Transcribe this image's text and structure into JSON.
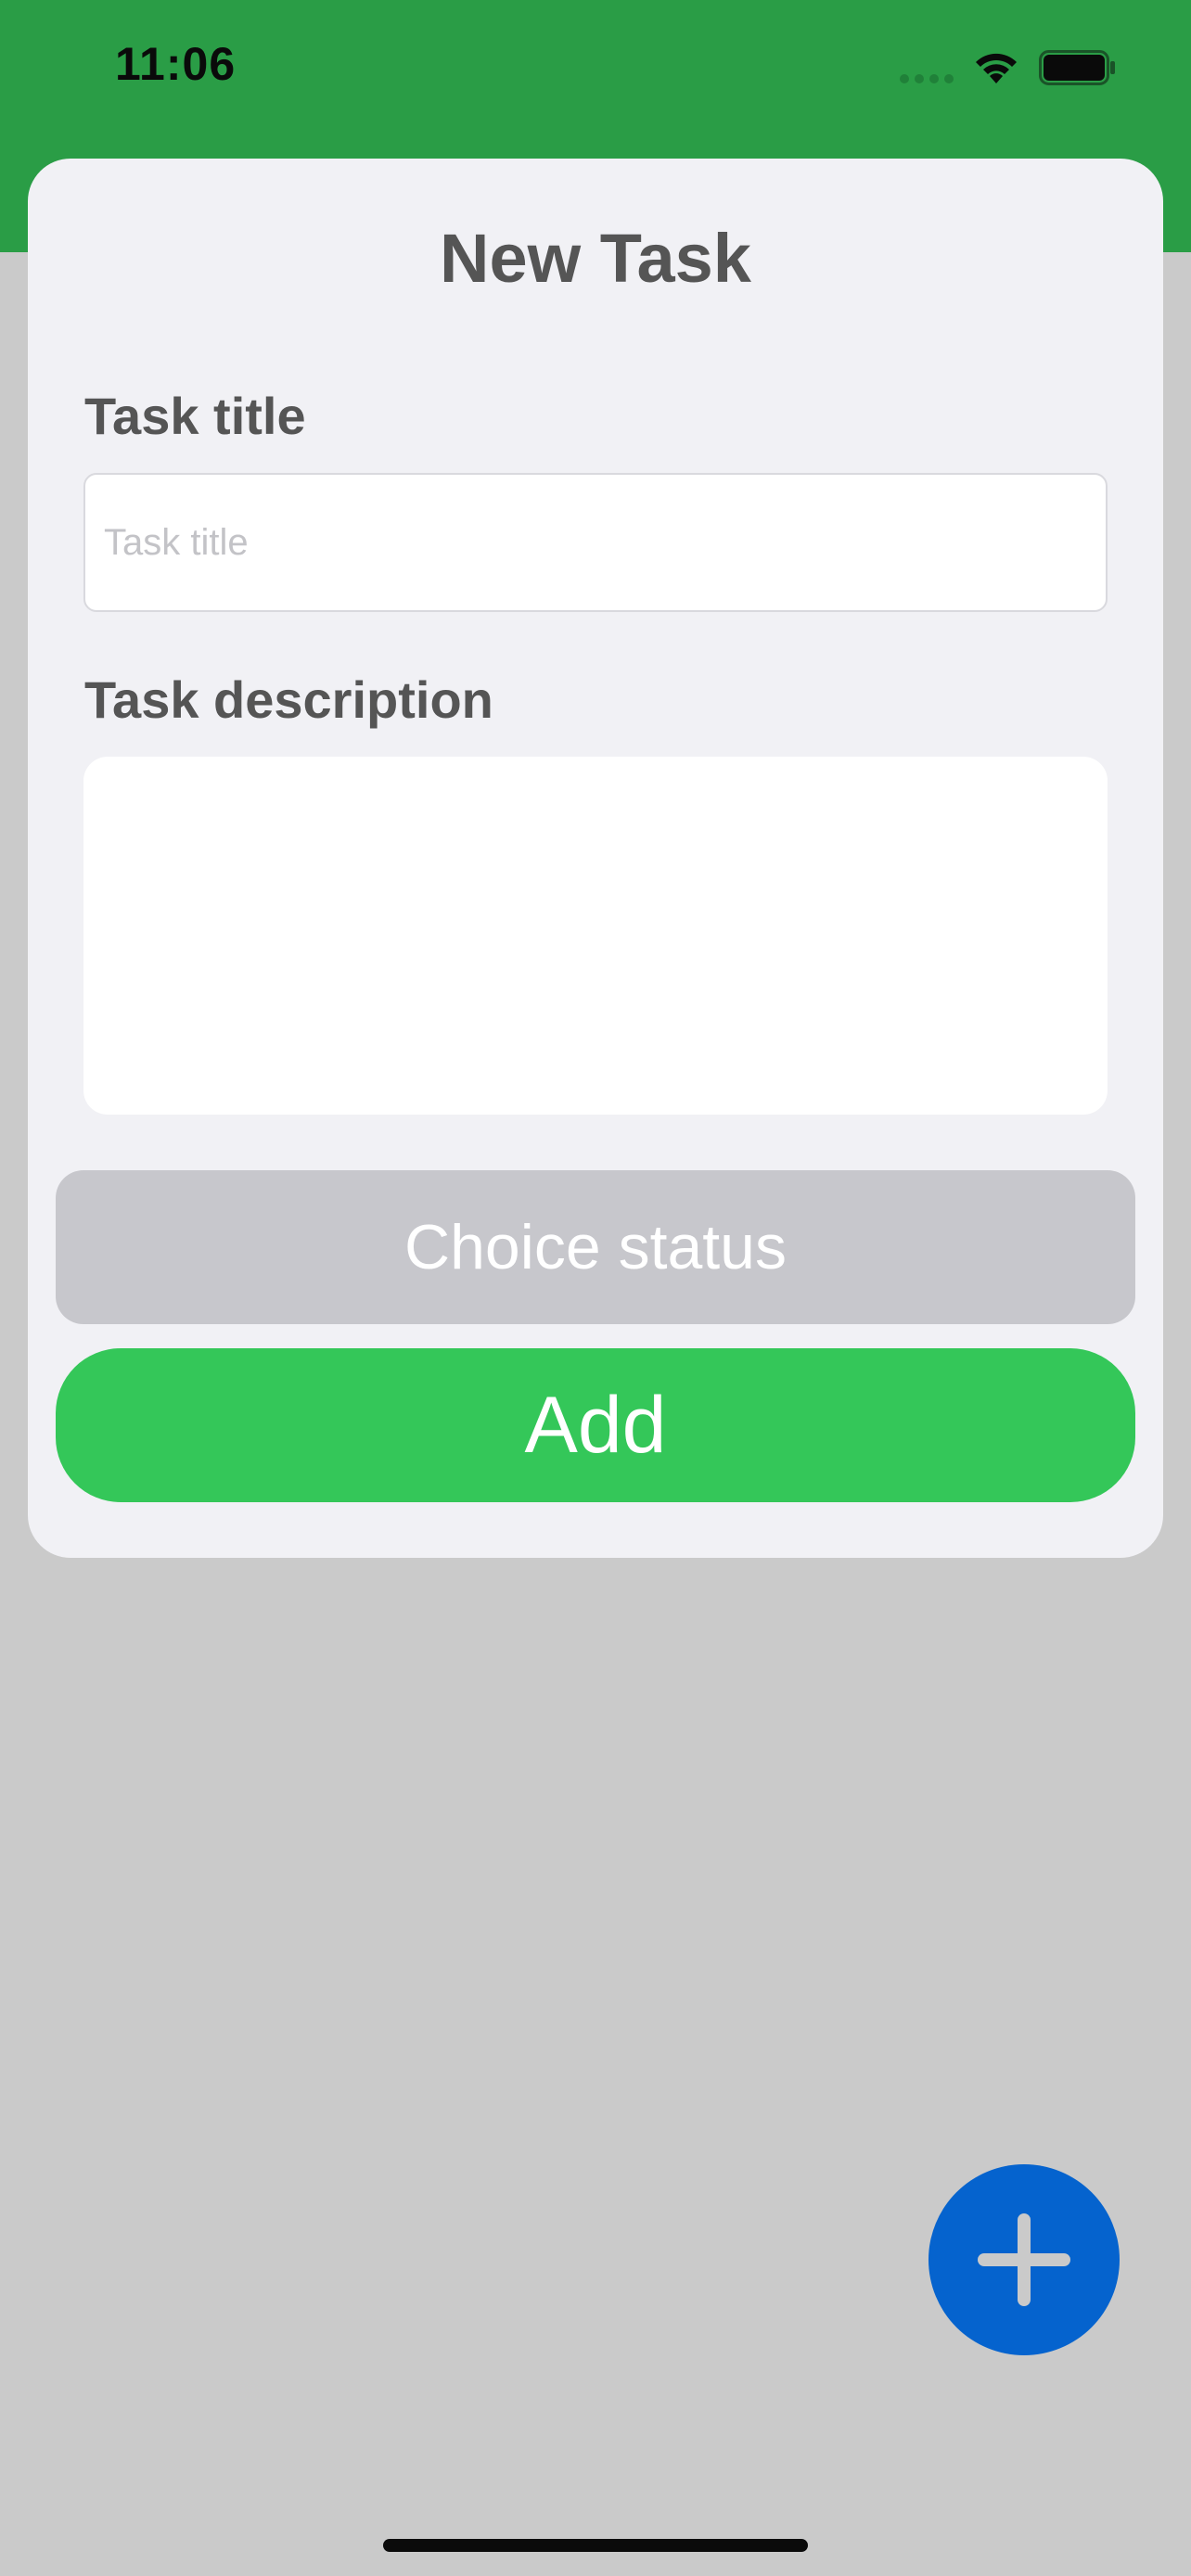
{
  "status_bar": {
    "time": "11:06"
  },
  "sheet": {
    "title": "New Task",
    "task_title_label": "Task title",
    "task_title_placeholder": "Task title",
    "task_title_value": "",
    "task_description_label": "Task description",
    "task_description_value": "",
    "status_button_label": "Choice status",
    "add_button_label": "Add"
  },
  "fab": {
    "icon": "plus-icon"
  },
  "colors": {
    "header_green": "#2a9d46",
    "add_green": "#34c759",
    "status_gray": "#c7c7cc",
    "fab_blue": "#0563ce",
    "backdrop": "#cacaca"
  }
}
